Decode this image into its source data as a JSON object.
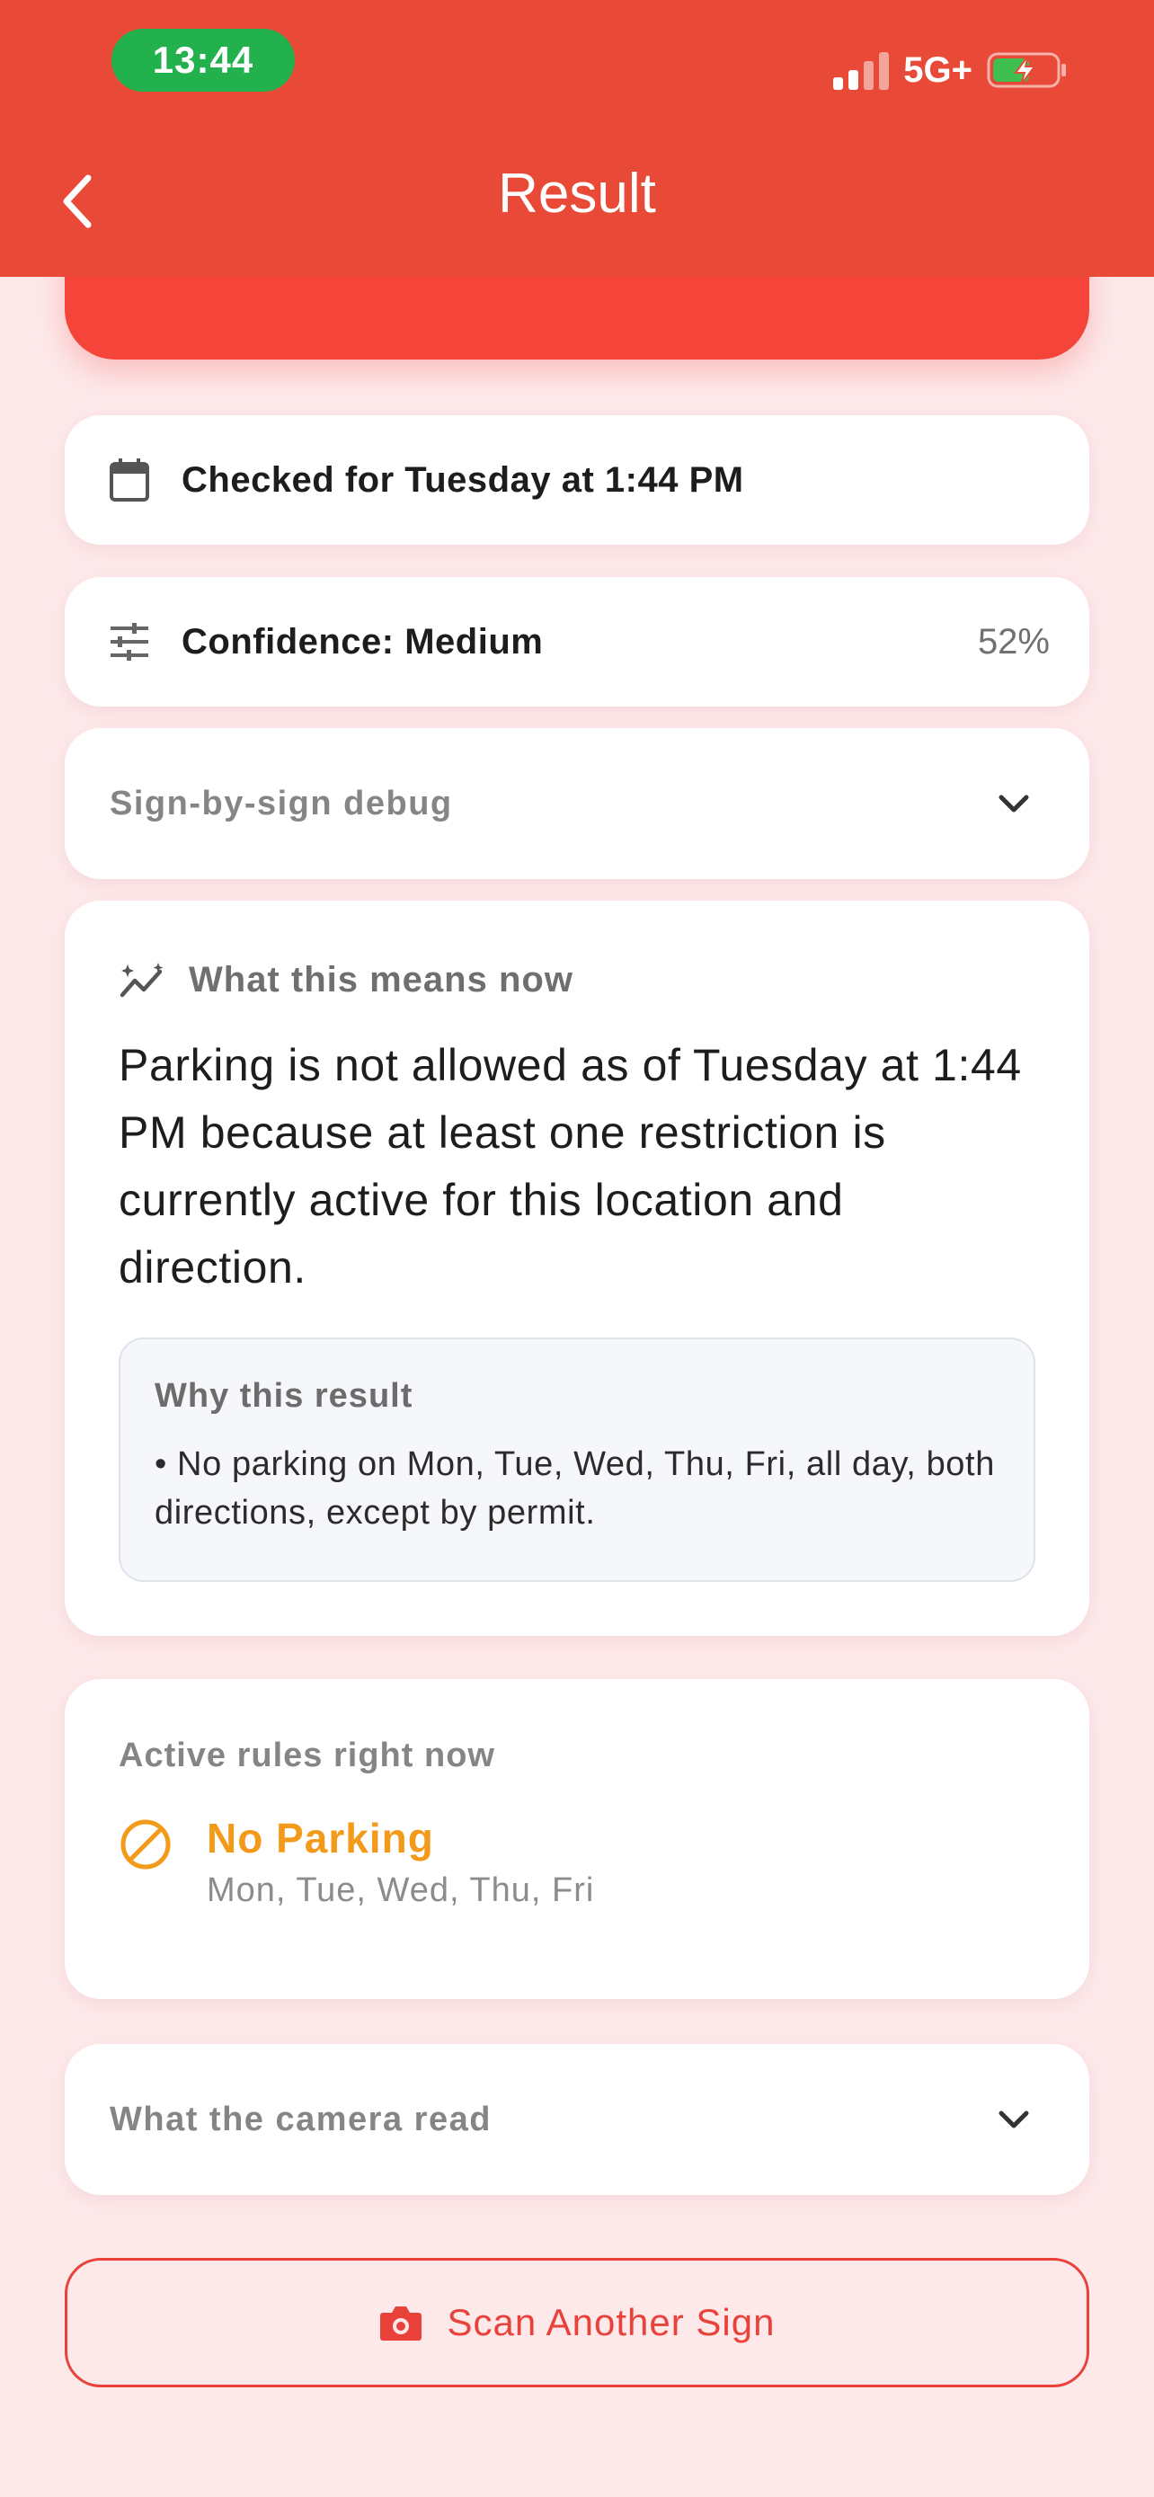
{
  "status_bar": {
    "time": "13:44",
    "network": "5G+"
  },
  "nav": {
    "title": "Result"
  },
  "checked": {
    "label": "Checked for Tuesday at 1:44 PM",
    "icon": "calendar-icon"
  },
  "confidence": {
    "label": "Confidence: Medium",
    "percent": "52%",
    "icon": "sliders-icon"
  },
  "debug": {
    "label": "Sign-by-sign debug"
  },
  "means": {
    "title": "What this means now",
    "body": "Parking is not allowed as of Tuesday at 1:44 PM because at least one restriction is currently active for this location and direction.",
    "why_title": "Why this result",
    "why_text": "• No parking on Mon, Tue, Wed, Thu, Fri, all day, both directions, except by permit."
  },
  "active_rules": {
    "title": "Active rules right now",
    "rules": [
      {
        "name": "No Parking",
        "days": "Mon, Tue, Wed, Thu, Fri",
        "color": "#f39a1a",
        "icon": "no-entry-icon"
      }
    ]
  },
  "camera": {
    "label": "What the camera read"
  },
  "scan_button": {
    "label": "Scan Another Sign",
    "icon": "camera-icon"
  },
  "colors": {
    "header": "#e84a37",
    "accent": "#e8423a",
    "warning": "#f39a1a",
    "background": "#fde8ea"
  }
}
